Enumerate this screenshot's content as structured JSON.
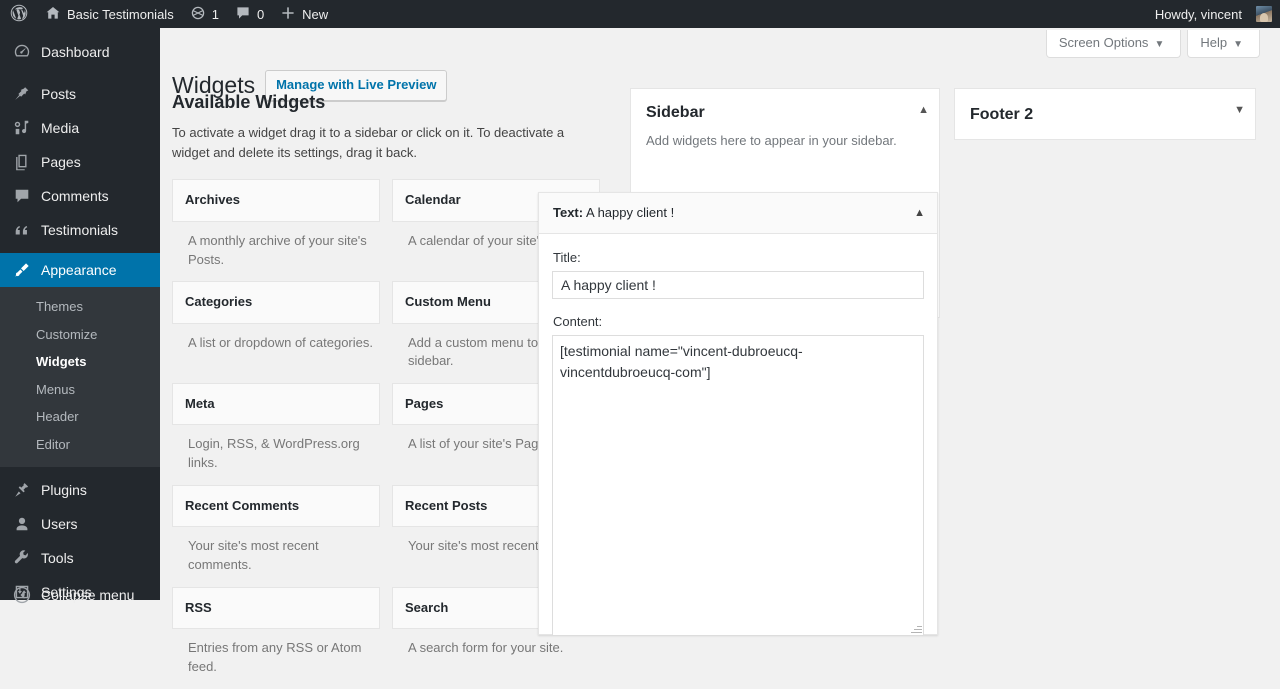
{
  "adminbar": {
    "logo_icon": "wordpress-logo-icon",
    "site_name": "Basic Testimonials",
    "home_icon": "home-icon",
    "updates_icon": "updates-icon",
    "updates_count": "1",
    "comments_icon": "comment-bubble-icon",
    "comments_count": "0",
    "new_icon": "plus-icon",
    "new_label": "New",
    "howdy": "Howdy, vincent",
    "avatar": "user-avatar"
  },
  "adminmenu": {
    "items": [
      {
        "label": "Dashboard",
        "icon": "dashboard-icon",
        "current": false
      },
      {
        "label": "Posts",
        "icon": "pin-icon",
        "current": false
      },
      {
        "label": "Media",
        "icon": "media-icon",
        "current": false
      },
      {
        "label": "Pages",
        "icon": "pages-icon",
        "current": false
      },
      {
        "label": "Comments",
        "icon": "comment-bubble-icon",
        "current": false
      },
      {
        "label": "Testimonials",
        "icon": "quote-icon",
        "current": false
      },
      {
        "label": "Appearance",
        "icon": "paintbrush-icon",
        "current": true
      },
      {
        "label": "Plugins",
        "icon": "plugin-icon",
        "current": false
      },
      {
        "label": "Users",
        "icon": "user-icon",
        "current": false
      },
      {
        "label": "Tools",
        "icon": "wrench-icon",
        "current": false
      },
      {
        "label": "Settings",
        "icon": "settings-icon",
        "current": false
      },
      {
        "label": "Collapse menu",
        "icon": "collapse-arrow-icon",
        "current": false
      }
    ],
    "appearance_submenu": [
      {
        "label": "Themes",
        "current": false
      },
      {
        "label": "Customize",
        "current": false
      },
      {
        "label": "Widgets",
        "current": true
      },
      {
        "label": "Menus",
        "current": false
      },
      {
        "label": "Header",
        "current": false
      },
      {
        "label": "Editor",
        "current": false
      }
    ],
    "highlight_color": "#0073aa"
  },
  "screen_meta": {
    "screen_options_label": "Screen Options",
    "help_label": "Help",
    "caret": "▼"
  },
  "page": {
    "title": "Widgets",
    "live_preview_button": "Manage with Live Preview"
  },
  "available_widgets": {
    "heading": "Available Widgets",
    "description": "To activate a widget drag it to a sidebar or click on it. To deactivate a widget and delete its settings, drag it back.",
    "items": [
      {
        "name": "Archives",
        "desc": "A monthly archive of your site's Posts."
      },
      {
        "name": "Calendar",
        "desc": "A calendar of your site's Posts."
      },
      {
        "name": "Categories",
        "desc": "A list or dropdown of categories."
      },
      {
        "name": "Custom Menu",
        "desc": "Add a custom menu to your sidebar."
      },
      {
        "name": "Meta",
        "desc": "Login, RSS, & WordPress.org links."
      },
      {
        "name": "Pages",
        "desc": "A list of your site's Pages."
      },
      {
        "name": "Recent Comments",
        "desc": "Your site's most recent comments."
      },
      {
        "name": "Recent Posts",
        "desc": "Your site's most recent Posts."
      },
      {
        "name": "RSS",
        "desc": "Entries from any RSS or Atom feed."
      },
      {
        "name": "Search",
        "desc": "A search form for your site."
      }
    ]
  },
  "sidebars": {
    "sidebar": {
      "title": "Sidebar",
      "description": "Add widgets here to appear in your sidebar.",
      "toggle_icon": "chevron-up-icon",
      "toggle_glyph": "▲"
    },
    "footer2": {
      "title": "Footer 2",
      "toggle_icon": "chevron-down-icon",
      "toggle_glyph": "▼"
    }
  },
  "text_widget": {
    "type_label": "Text:",
    "header_title": "A happy client !",
    "toggle_icon": "chevron-up-icon",
    "toggle_glyph": "▲",
    "title_label": "Title:",
    "title_value": "A happy client !",
    "title_placeholder": "",
    "content_label": "Content:",
    "content_value": "[testimonial name=\"vincent-dubroeucq-vincentdubroeucq-com\"]",
    "content_placeholder": ""
  }
}
